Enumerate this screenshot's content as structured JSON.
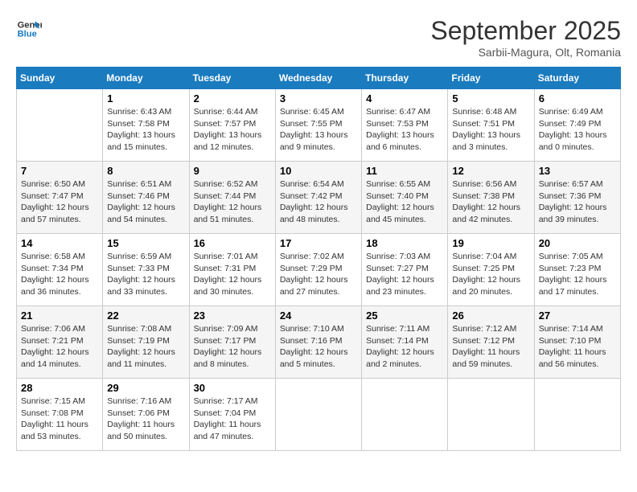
{
  "logo": {
    "line1": "General",
    "line2": "Blue"
  },
  "title": "September 2025",
  "subtitle": "Sarbii-Magura, Olt, Romania",
  "days_of_week": [
    "Sunday",
    "Monday",
    "Tuesday",
    "Wednesday",
    "Thursday",
    "Friday",
    "Saturday"
  ],
  "weeks": [
    [
      {
        "day": "",
        "info": ""
      },
      {
        "day": "1",
        "info": "Sunrise: 6:43 AM\nSunset: 7:58 PM\nDaylight: 13 hours\nand 15 minutes."
      },
      {
        "day": "2",
        "info": "Sunrise: 6:44 AM\nSunset: 7:57 PM\nDaylight: 13 hours\nand 12 minutes."
      },
      {
        "day": "3",
        "info": "Sunrise: 6:45 AM\nSunset: 7:55 PM\nDaylight: 13 hours\nand 9 minutes."
      },
      {
        "day": "4",
        "info": "Sunrise: 6:47 AM\nSunset: 7:53 PM\nDaylight: 13 hours\nand 6 minutes."
      },
      {
        "day": "5",
        "info": "Sunrise: 6:48 AM\nSunset: 7:51 PM\nDaylight: 13 hours\nand 3 minutes."
      },
      {
        "day": "6",
        "info": "Sunrise: 6:49 AM\nSunset: 7:49 PM\nDaylight: 13 hours\nand 0 minutes."
      }
    ],
    [
      {
        "day": "7",
        "info": "Sunrise: 6:50 AM\nSunset: 7:47 PM\nDaylight: 12 hours\nand 57 minutes."
      },
      {
        "day": "8",
        "info": "Sunrise: 6:51 AM\nSunset: 7:46 PM\nDaylight: 12 hours\nand 54 minutes."
      },
      {
        "day": "9",
        "info": "Sunrise: 6:52 AM\nSunset: 7:44 PM\nDaylight: 12 hours\nand 51 minutes."
      },
      {
        "day": "10",
        "info": "Sunrise: 6:54 AM\nSunset: 7:42 PM\nDaylight: 12 hours\nand 48 minutes."
      },
      {
        "day": "11",
        "info": "Sunrise: 6:55 AM\nSunset: 7:40 PM\nDaylight: 12 hours\nand 45 minutes."
      },
      {
        "day": "12",
        "info": "Sunrise: 6:56 AM\nSunset: 7:38 PM\nDaylight: 12 hours\nand 42 minutes."
      },
      {
        "day": "13",
        "info": "Sunrise: 6:57 AM\nSunset: 7:36 PM\nDaylight: 12 hours\nand 39 minutes."
      }
    ],
    [
      {
        "day": "14",
        "info": "Sunrise: 6:58 AM\nSunset: 7:34 PM\nDaylight: 12 hours\nand 36 minutes."
      },
      {
        "day": "15",
        "info": "Sunrise: 6:59 AM\nSunset: 7:33 PM\nDaylight: 12 hours\nand 33 minutes."
      },
      {
        "day": "16",
        "info": "Sunrise: 7:01 AM\nSunset: 7:31 PM\nDaylight: 12 hours\nand 30 minutes."
      },
      {
        "day": "17",
        "info": "Sunrise: 7:02 AM\nSunset: 7:29 PM\nDaylight: 12 hours\nand 27 minutes."
      },
      {
        "day": "18",
        "info": "Sunrise: 7:03 AM\nSunset: 7:27 PM\nDaylight: 12 hours\nand 23 minutes."
      },
      {
        "day": "19",
        "info": "Sunrise: 7:04 AM\nSunset: 7:25 PM\nDaylight: 12 hours\nand 20 minutes."
      },
      {
        "day": "20",
        "info": "Sunrise: 7:05 AM\nSunset: 7:23 PM\nDaylight: 12 hours\nand 17 minutes."
      }
    ],
    [
      {
        "day": "21",
        "info": "Sunrise: 7:06 AM\nSunset: 7:21 PM\nDaylight: 12 hours\nand 14 minutes."
      },
      {
        "day": "22",
        "info": "Sunrise: 7:08 AM\nSunset: 7:19 PM\nDaylight: 12 hours\nand 11 minutes."
      },
      {
        "day": "23",
        "info": "Sunrise: 7:09 AM\nSunset: 7:17 PM\nDaylight: 12 hours\nand 8 minutes."
      },
      {
        "day": "24",
        "info": "Sunrise: 7:10 AM\nSunset: 7:16 PM\nDaylight: 12 hours\nand 5 minutes."
      },
      {
        "day": "25",
        "info": "Sunrise: 7:11 AM\nSunset: 7:14 PM\nDaylight: 12 hours\nand 2 minutes."
      },
      {
        "day": "26",
        "info": "Sunrise: 7:12 AM\nSunset: 7:12 PM\nDaylight: 11 hours\nand 59 minutes."
      },
      {
        "day": "27",
        "info": "Sunrise: 7:14 AM\nSunset: 7:10 PM\nDaylight: 11 hours\nand 56 minutes."
      }
    ],
    [
      {
        "day": "28",
        "info": "Sunrise: 7:15 AM\nSunset: 7:08 PM\nDaylight: 11 hours\nand 53 minutes."
      },
      {
        "day": "29",
        "info": "Sunrise: 7:16 AM\nSunset: 7:06 PM\nDaylight: 11 hours\nand 50 minutes."
      },
      {
        "day": "30",
        "info": "Sunrise: 7:17 AM\nSunset: 7:04 PM\nDaylight: 11 hours\nand 47 minutes."
      },
      {
        "day": "",
        "info": ""
      },
      {
        "day": "",
        "info": ""
      },
      {
        "day": "",
        "info": ""
      },
      {
        "day": "",
        "info": ""
      }
    ]
  ]
}
